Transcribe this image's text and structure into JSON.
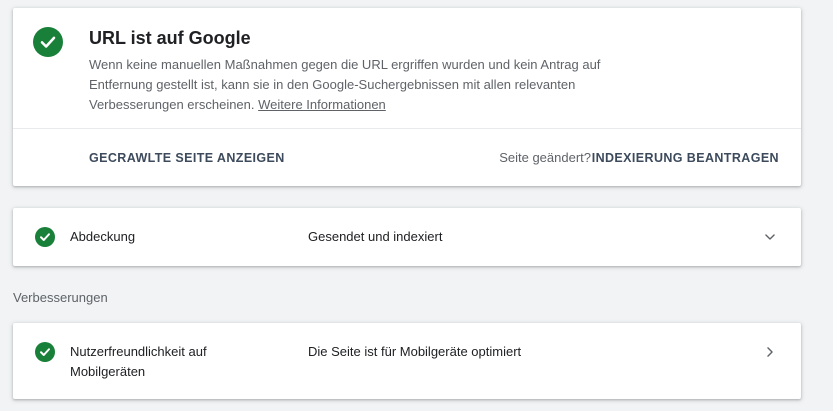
{
  "status": {
    "title": "URL ist auf Google",
    "description": "Wenn keine manuellen Maßnahmen gegen die URL ergriffen wurden und kein Antrag auf Entfernung gestellt ist, kann sie in den Google-Suchergebnissen mit allen relevanten Verbesserungen erscheinen. ",
    "more_info_link": "Weitere Informationen",
    "icon": "check-circle-icon"
  },
  "actions": {
    "view_crawled": "GECRAWLTE SEITE ANZEIGEN",
    "page_changed": "Seite geändert?",
    "request_indexing": "INDEXIERUNG BEANTRAGEN"
  },
  "coverage": {
    "label": "Abdeckung",
    "value": "Gesendet und indexiert",
    "icon": "check-circle-icon",
    "toggle_icon": "chevron-down-icon"
  },
  "enhancements": {
    "section_title": "Verbesserungen",
    "items": [
      {
        "label": "Nutzerfreundlichkeit auf Mobilgeräten",
        "value": "Die Seite ist für Mobilgeräte optimiert",
        "icon": "check-circle-icon",
        "toggle_icon": "chevron-right-icon"
      }
    ]
  },
  "colors": {
    "success": "#188038",
    "background": "#f1f3f4",
    "card": "#ffffff",
    "secondary_text": "#5f6368",
    "action_text": "#3c4a5c"
  }
}
